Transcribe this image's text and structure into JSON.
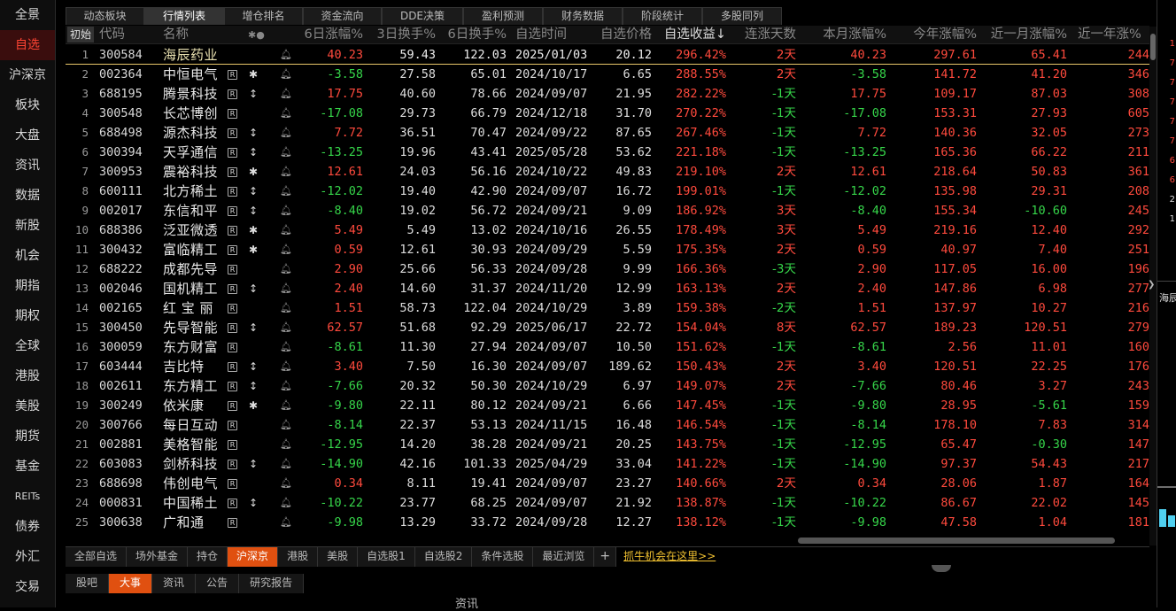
{
  "sidebar": {
    "items": [
      {
        "label": "全景",
        "active": false
      },
      {
        "label": "自选",
        "active": true
      },
      {
        "label": "沪深京",
        "active": false
      },
      {
        "label": "板块",
        "active": false
      },
      {
        "label": "大盘",
        "active": false
      },
      {
        "label": "资讯",
        "active": false
      },
      {
        "label": "数据",
        "active": false
      },
      {
        "label": "新股",
        "active": false
      },
      {
        "label": "机会",
        "active": false
      },
      {
        "label": "期指",
        "active": false
      },
      {
        "label": "期权",
        "active": false
      },
      {
        "label": "全球",
        "active": false
      },
      {
        "label": "港股",
        "active": false
      },
      {
        "label": "美股",
        "active": false
      },
      {
        "label": "期货",
        "active": false
      },
      {
        "label": "基金",
        "active": false
      },
      {
        "label": "REITs",
        "active": false
      },
      {
        "label": "债券",
        "active": false
      },
      {
        "label": "外汇",
        "active": false
      },
      {
        "label": "交易",
        "active": false
      }
    ]
  },
  "top_tabs": [
    {
      "label": "动态板块",
      "active": false
    },
    {
      "label": "行情列表",
      "active": true
    },
    {
      "label": "增仓排名",
      "active": false
    },
    {
      "label": "资金流向",
      "active": false
    },
    {
      "label": "DDE决策",
      "active": false
    },
    {
      "label": "盈利预测",
      "active": false
    },
    {
      "label": "财务数据",
      "active": false
    },
    {
      "label": "阶段统计",
      "active": false
    },
    {
      "label": "多股同列",
      "active": false
    }
  ],
  "header": {
    "init": "初始",
    "code": "代码",
    "name": "名称",
    "marks": "✱●",
    "chg6": "6日涨幅%",
    "turn3": "3日换手%",
    "turn6": "6日换手%",
    "add_time": "自选时间",
    "add_price": "自选价格",
    "add_return": "自选收益↓",
    "up_days": "连涨天数",
    "month_chg": "本月涨幅%",
    "year_chg": "今年涨幅%",
    "m1_chg": "近一月涨幅%",
    "y1_chg": "近一年涨%"
  },
  "rows": [
    {
      "i": "1",
      "code": "300584",
      "name": "海辰药业",
      "r": false,
      "g": "",
      "chg6": "40.23",
      "t3": "59.43",
      "t6": "122.03",
      "dt": "2025/01/03",
      "px": "20.12",
      "ret": "296.42%",
      "days": "2天",
      "mon": "40.23",
      "yr": "297.61",
      "m1": "65.41",
      "y1": "244"
    },
    {
      "i": "2",
      "code": "002364",
      "name": "中恒电气",
      "r": true,
      "g": "✱",
      "chg6": "-3.58",
      "t3": "27.58",
      "t6": "65.01",
      "dt": "2024/10/17",
      "px": "6.65",
      "ret": "288.55%",
      "days": "2天",
      "mon": "-3.58",
      "yr": "141.72",
      "m1": "41.20",
      "y1": "346"
    },
    {
      "i": "3",
      "code": "688195",
      "name": "腾景科技",
      "r": true,
      "g": "↕",
      "chg6": "17.75",
      "t3": "40.60",
      "t6": "78.66",
      "dt": "2024/09/07",
      "px": "21.95",
      "ret": "282.22%",
      "days": "-1天",
      "mon": "17.75",
      "yr": "109.17",
      "m1": "87.03",
      "y1": "308"
    },
    {
      "i": "4",
      "code": "300548",
      "name": "长芯博创",
      "r": true,
      "g": "",
      "chg6": "-17.08",
      "t3": "29.73",
      "t6": "66.79",
      "dt": "2024/12/18",
      "px": "31.70",
      "ret": "270.22%",
      "days": "-1天",
      "mon": "-17.08",
      "yr": "153.31",
      "m1": "27.93",
      "y1": "605"
    },
    {
      "i": "5",
      "code": "688498",
      "name": "源杰科技",
      "r": true,
      "g": "↕",
      "chg6": "7.72",
      "t3": "36.51",
      "t6": "70.47",
      "dt": "2024/09/22",
      "px": "87.65",
      "ret": "267.46%",
      "days": "-1天",
      "mon": "7.72",
      "yr": "140.36",
      "m1": "32.05",
      "y1": "273"
    },
    {
      "i": "6",
      "code": "300394",
      "name": "天孚通信",
      "r": true,
      "g": "↕",
      "chg6": "-13.25",
      "t3": "19.96",
      "t6": "43.41",
      "dt": "2025/05/28",
      "px": "53.62",
      "ret": "221.18%",
      "days": "-1天",
      "mon": "-13.25",
      "yr": "165.36",
      "m1": "66.22",
      "y1": "211"
    },
    {
      "i": "7",
      "code": "300953",
      "name": "震裕科技",
      "r": true,
      "g": "✱",
      "chg6": "12.61",
      "t3": "24.03",
      "t6": "56.16",
      "dt": "2024/10/22",
      "px": "49.83",
      "ret": "219.10%",
      "days": "2天",
      "mon": "12.61",
      "yr": "218.64",
      "m1": "50.83",
      "y1": "361"
    },
    {
      "i": "8",
      "code": "600111",
      "name": "北方稀土",
      "r": true,
      "g": "↕",
      "chg6": "-12.02",
      "t3": "19.40",
      "t6": "42.90",
      "dt": "2024/09/07",
      "px": "16.72",
      "ret": "199.01%",
      "days": "-1天",
      "mon": "-12.02",
      "yr": "135.98",
      "m1": "29.31",
      "y1": "208"
    },
    {
      "i": "9",
      "code": "002017",
      "name": "东信和平",
      "r": true,
      "g": "↕",
      "chg6": "-8.40",
      "t3": "19.02",
      "t6": "56.72",
      "dt": "2024/09/21",
      "px": "9.09",
      "ret": "186.92%",
      "days": "3天",
      "mon": "-8.40",
      "yr": "155.34",
      "m1": "-10.60",
      "y1": "245"
    },
    {
      "i": "10",
      "code": "688386",
      "name": "泛亚微透",
      "r": true,
      "g": "✱",
      "chg6": "5.49",
      "t3": "5.49",
      "t6": "13.02",
      "dt": "2024/10/16",
      "px": "26.55",
      "ret": "178.49%",
      "days": "3天",
      "mon": "5.49",
      "yr": "219.16",
      "m1": "12.40",
      "y1": "292"
    },
    {
      "i": "11",
      "code": "300432",
      "name": "富临精工",
      "r": true,
      "g": "✱",
      "chg6": "0.59",
      "t3": "12.61",
      "t6": "30.93",
      "dt": "2024/09/29",
      "px": "5.59",
      "ret": "175.35%",
      "days": "2天",
      "mon": "0.59",
      "yr": "40.97",
      "m1": "7.40",
      "y1": "251"
    },
    {
      "i": "12",
      "code": "688222",
      "name": "成都先导",
      "r": true,
      "g": "",
      "chg6": "2.90",
      "t3": "25.66",
      "t6": "56.33",
      "dt": "2024/09/28",
      "px": "9.99",
      "ret": "166.36%",
      "days": "-3天",
      "mon": "2.90",
      "yr": "117.05",
      "m1": "16.00",
      "y1": "196"
    },
    {
      "i": "13",
      "code": "002046",
      "name": "国机精工",
      "r": true,
      "g": "↕",
      "chg6": "2.40",
      "t3": "14.60",
      "t6": "31.37",
      "dt": "2024/11/20",
      "px": "12.99",
      "ret": "163.13%",
      "days": "2天",
      "mon": "2.40",
      "yr": "147.86",
      "m1": "6.98",
      "y1": "277"
    },
    {
      "i": "14",
      "code": "002165",
      "name": "红 宝 丽",
      "r": true,
      "g": "",
      "chg6": "1.51",
      "t3": "58.73",
      "t6": "122.04",
      "dt": "2024/10/29",
      "px": "3.89",
      "ret": "159.38%",
      "days": "-2天",
      "mon": "1.51",
      "yr": "137.97",
      "m1": "10.27",
      "y1": "216"
    },
    {
      "i": "15",
      "code": "300450",
      "name": "先导智能",
      "r": true,
      "g": "↕",
      "chg6": "62.57",
      "t3": "51.68",
      "t6": "92.29",
      "dt": "2025/06/17",
      "px": "22.72",
      "ret": "154.04%",
      "days": "8天",
      "mon": "62.57",
      "yr": "189.23",
      "m1": "120.51",
      "y1": "279"
    },
    {
      "i": "16",
      "code": "300059",
      "name": "东方财富",
      "r": true,
      "g": "",
      "chg6": "-8.61",
      "t3": "11.30",
      "t6": "27.94",
      "dt": "2024/09/07",
      "px": "10.50",
      "ret": "151.62%",
      "days": "-1天",
      "mon": "-8.61",
      "yr": "2.56",
      "m1": "11.01",
      "y1": "160"
    },
    {
      "i": "17",
      "code": "603444",
      "name": "吉比特",
      "r": true,
      "g": "↕",
      "chg6": "3.40",
      "t3": "7.50",
      "t6": "16.30",
      "dt": "2024/09/07",
      "px": "189.62",
      "ret": "150.43%",
      "days": "2天",
      "mon": "3.40",
      "yr": "120.51",
      "m1": "22.25",
      "y1": "176"
    },
    {
      "i": "18",
      "code": "002611",
      "name": "东方精工",
      "r": true,
      "g": "↕",
      "chg6": "-7.66",
      "t3": "20.32",
      "t6": "50.30",
      "dt": "2024/10/29",
      "px": "6.97",
      "ret": "149.07%",
      "days": "2天",
      "mon": "-7.66",
      "yr": "80.46",
      "m1": "3.27",
      "y1": "243"
    },
    {
      "i": "19",
      "code": "300249",
      "name": "依米康",
      "r": true,
      "g": "✱",
      "chg6": "-9.80",
      "t3": "22.11",
      "t6": "80.12",
      "dt": "2024/09/21",
      "px": "6.66",
      "ret": "147.45%",
      "days": "-1天",
      "mon": "-9.80",
      "yr": "28.95",
      "m1": "-5.61",
      "y1": "159"
    },
    {
      "i": "20",
      "code": "300766",
      "name": "每日互动",
      "r": true,
      "g": "",
      "chg6": "-8.14",
      "t3": "22.37",
      "t6": "53.13",
      "dt": "2024/11/15",
      "px": "16.48",
      "ret": "146.54%",
      "days": "-1天",
      "mon": "-8.14",
      "yr": "178.10",
      "m1": "7.83",
      "y1": "314"
    },
    {
      "i": "21",
      "code": "002881",
      "name": "美格智能",
      "r": true,
      "g": "",
      "chg6": "-12.95",
      "t3": "14.20",
      "t6": "38.28",
      "dt": "2024/09/21",
      "px": "20.25",
      "ret": "143.75%",
      "days": "-1天",
      "mon": "-12.95",
      "yr": "65.47",
      "m1": "-0.30",
      "y1": "147"
    },
    {
      "i": "22",
      "code": "603083",
      "name": "剑桥科技",
      "r": true,
      "g": "↕",
      "chg6": "-14.90",
      "t3": "42.16",
      "t6": "101.33",
      "dt": "2025/04/29",
      "px": "33.04",
      "ret": "141.22%",
      "days": "-1天",
      "mon": "-14.90",
      "yr": "97.37",
      "m1": "54.43",
      "y1": "217"
    },
    {
      "i": "23",
      "code": "688698",
      "name": "伟创电气",
      "r": true,
      "g": "",
      "chg6": "0.34",
      "t3": "8.11",
      "t6": "19.41",
      "dt": "2024/09/07",
      "px": "23.27",
      "ret": "140.66%",
      "days": "2天",
      "mon": "0.34",
      "yr": "28.06",
      "m1": "1.87",
      "y1": "164"
    },
    {
      "i": "24",
      "code": "000831",
      "name": "中国稀土",
      "r": true,
      "g": "↕",
      "chg6": "-10.22",
      "t3": "23.77",
      "t6": "68.25",
      "dt": "2024/09/07",
      "px": "21.92",
      "ret": "138.87%",
      "days": "-1天",
      "mon": "-10.22",
      "yr": "86.67",
      "m1": "22.02",
      "y1": "145"
    },
    {
      "i": "25",
      "code": "300638",
      "name": "广和通",
      "r": true,
      "g": "",
      "chg6": "-9.98",
      "t3": "13.29",
      "t6": "33.72",
      "dt": "2024/09/28",
      "px": "12.27",
      "ret": "138.12%",
      "days": "-1天",
      "mon": "-9.98",
      "yr": "47.58",
      "m1": "1.04",
      "y1": "181"
    }
  ],
  "bottom_tabs": [
    {
      "label": "全部自选",
      "active": false
    },
    {
      "label": "场外基金",
      "active": false
    },
    {
      "label": "持仓",
      "active": false
    },
    {
      "label": "沪深京",
      "active": true
    },
    {
      "label": "港股",
      "active": false
    },
    {
      "label": "美股",
      "active": false
    },
    {
      "label": "自选股1",
      "active": false
    },
    {
      "label": "自选股2",
      "active": false
    },
    {
      "label": "条件选股",
      "active": false
    },
    {
      "label": "最近浏览",
      "active": false
    }
  ],
  "bottom_plus": "+",
  "bottom_link": "抓牛机会在这里>>",
  "info_tabs": [
    {
      "label": "股吧",
      "active": false
    },
    {
      "label": "大事",
      "active": true
    },
    {
      "label": "资讯",
      "active": false
    },
    {
      "label": "公告",
      "active": false
    },
    {
      "label": "研究报告",
      "active": false
    }
  ],
  "info_label": "资讯",
  "right_panel": {
    "label": "海辰",
    "nums": [
      {
        "t": "1",
        "c": "up"
      },
      {
        "t": "7",
        "c": "up"
      },
      {
        "t": "7",
        "c": "up"
      },
      {
        "t": "7",
        "c": "up"
      },
      {
        "t": "7",
        "c": "up"
      },
      {
        "t": "7",
        "c": "up"
      },
      {
        "t": "6",
        "c": "up"
      },
      {
        "t": "6",
        "c": "up"
      },
      {
        "t": "2",
        "c": "w"
      },
      {
        "t": "1",
        "c": "w"
      }
    ]
  },
  "colors": {
    "up": "#ff4a3d",
    "down": "#36d64a",
    "active_tab": "#e05010",
    "link": "#f0c030",
    "first_row_line": "#e8c76a"
  }
}
